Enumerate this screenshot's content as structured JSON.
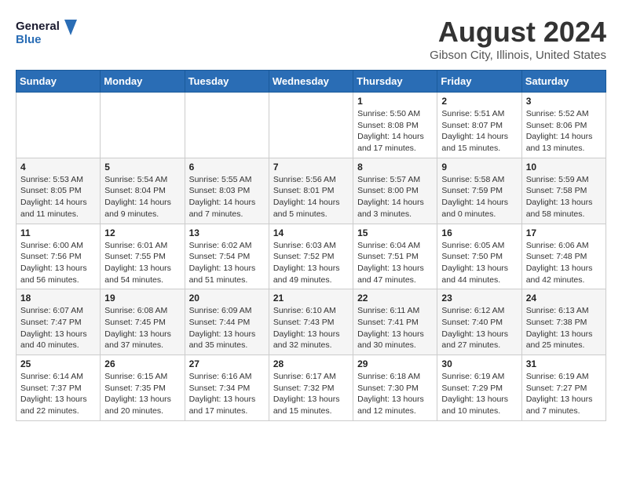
{
  "header": {
    "logo_line1": "General",
    "logo_line2": "Blue",
    "title": "August 2024",
    "subtitle": "Gibson City, Illinois, United States"
  },
  "calendar": {
    "days_of_week": [
      "Sunday",
      "Monday",
      "Tuesday",
      "Wednesday",
      "Thursday",
      "Friday",
      "Saturday"
    ],
    "weeks": [
      [
        {
          "day": "",
          "info": ""
        },
        {
          "day": "",
          "info": ""
        },
        {
          "day": "",
          "info": ""
        },
        {
          "day": "",
          "info": ""
        },
        {
          "day": "1",
          "info": "Sunrise: 5:50 AM\nSunset: 8:08 PM\nDaylight: 14 hours\nand 17 minutes."
        },
        {
          "day": "2",
          "info": "Sunrise: 5:51 AM\nSunset: 8:07 PM\nDaylight: 14 hours\nand 15 minutes."
        },
        {
          "day": "3",
          "info": "Sunrise: 5:52 AM\nSunset: 8:06 PM\nDaylight: 14 hours\nand 13 minutes."
        }
      ],
      [
        {
          "day": "4",
          "info": "Sunrise: 5:53 AM\nSunset: 8:05 PM\nDaylight: 14 hours\nand 11 minutes."
        },
        {
          "day": "5",
          "info": "Sunrise: 5:54 AM\nSunset: 8:04 PM\nDaylight: 14 hours\nand 9 minutes."
        },
        {
          "day": "6",
          "info": "Sunrise: 5:55 AM\nSunset: 8:03 PM\nDaylight: 14 hours\nand 7 minutes."
        },
        {
          "day": "7",
          "info": "Sunrise: 5:56 AM\nSunset: 8:01 PM\nDaylight: 14 hours\nand 5 minutes."
        },
        {
          "day": "8",
          "info": "Sunrise: 5:57 AM\nSunset: 8:00 PM\nDaylight: 14 hours\nand 3 minutes."
        },
        {
          "day": "9",
          "info": "Sunrise: 5:58 AM\nSunset: 7:59 PM\nDaylight: 14 hours\nand 0 minutes."
        },
        {
          "day": "10",
          "info": "Sunrise: 5:59 AM\nSunset: 7:58 PM\nDaylight: 13 hours\nand 58 minutes."
        }
      ],
      [
        {
          "day": "11",
          "info": "Sunrise: 6:00 AM\nSunset: 7:56 PM\nDaylight: 13 hours\nand 56 minutes."
        },
        {
          "day": "12",
          "info": "Sunrise: 6:01 AM\nSunset: 7:55 PM\nDaylight: 13 hours\nand 54 minutes."
        },
        {
          "day": "13",
          "info": "Sunrise: 6:02 AM\nSunset: 7:54 PM\nDaylight: 13 hours\nand 51 minutes."
        },
        {
          "day": "14",
          "info": "Sunrise: 6:03 AM\nSunset: 7:52 PM\nDaylight: 13 hours\nand 49 minutes."
        },
        {
          "day": "15",
          "info": "Sunrise: 6:04 AM\nSunset: 7:51 PM\nDaylight: 13 hours\nand 47 minutes."
        },
        {
          "day": "16",
          "info": "Sunrise: 6:05 AM\nSunset: 7:50 PM\nDaylight: 13 hours\nand 44 minutes."
        },
        {
          "day": "17",
          "info": "Sunrise: 6:06 AM\nSunset: 7:48 PM\nDaylight: 13 hours\nand 42 minutes."
        }
      ],
      [
        {
          "day": "18",
          "info": "Sunrise: 6:07 AM\nSunset: 7:47 PM\nDaylight: 13 hours\nand 40 minutes."
        },
        {
          "day": "19",
          "info": "Sunrise: 6:08 AM\nSunset: 7:45 PM\nDaylight: 13 hours\nand 37 minutes."
        },
        {
          "day": "20",
          "info": "Sunrise: 6:09 AM\nSunset: 7:44 PM\nDaylight: 13 hours\nand 35 minutes."
        },
        {
          "day": "21",
          "info": "Sunrise: 6:10 AM\nSunset: 7:43 PM\nDaylight: 13 hours\nand 32 minutes."
        },
        {
          "day": "22",
          "info": "Sunrise: 6:11 AM\nSunset: 7:41 PM\nDaylight: 13 hours\nand 30 minutes."
        },
        {
          "day": "23",
          "info": "Sunrise: 6:12 AM\nSunset: 7:40 PM\nDaylight: 13 hours\nand 27 minutes."
        },
        {
          "day": "24",
          "info": "Sunrise: 6:13 AM\nSunset: 7:38 PM\nDaylight: 13 hours\nand 25 minutes."
        }
      ],
      [
        {
          "day": "25",
          "info": "Sunrise: 6:14 AM\nSunset: 7:37 PM\nDaylight: 13 hours\nand 22 minutes."
        },
        {
          "day": "26",
          "info": "Sunrise: 6:15 AM\nSunset: 7:35 PM\nDaylight: 13 hours\nand 20 minutes."
        },
        {
          "day": "27",
          "info": "Sunrise: 6:16 AM\nSunset: 7:34 PM\nDaylight: 13 hours\nand 17 minutes."
        },
        {
          "day": "28",
          "info": "Sunrise: 6:17 AM\nSunset: 7:32 PM\nDaylight: 13 hours\nand 15 minutes."
        },
        {
          "day": "29",
          "info": "Sunrise: 6:18 AM\nSunset: 7:30 PM\nDaylight: 13 hours\nand 12 minutes."
        },
        {
          "day": "30",
          "info": "Sunrise: 6:19 AM\nSunset: 7:29 PM\nDaylight: 13 hours\nand 10 minutes."
        },
        {
          "day": "31",
          "info": "Sunrise: 6:19 AM\nSunset: 7:27 PM\nDaylight: 13 hours\nand 7 minutes."
        }
      ]
    ]
  }
}
